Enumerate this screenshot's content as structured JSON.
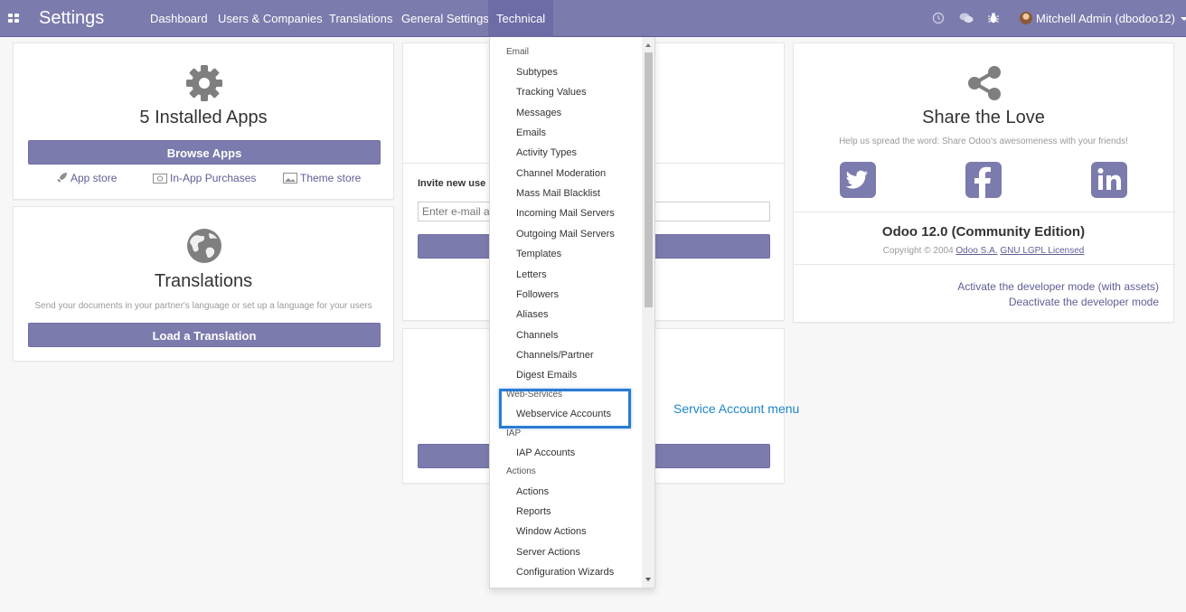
{
  "navbar": {
    "app_title": "Settings",
    "menu": [
      "Dashboard",
      "Users & Companies",
      "Translations",
      "General Settings",
      "Technical"
    ],
    "active_menu": "Technical",
    "user": "Mitchell Admin (dbodoo12)",
    "icons": [
      "apps-grid-icon",
      "clock-icon",
      "chat-icon",
      "bug-icon"
    ]
  },
  "apps_card": {
    "icon": "gear-icon",
    "title": "5 Installed Apps",
    "button": "Browse Apps",
    "links": [
      "App store",
      "In-App Purchases",
      "Theme store"
    ]
  },
  "translations_card": {
    "icon": "globe-icon",
    "title": "Translations",
    "subtitle": "Send your documents in your partner's language or set up a language for your users",
    "button": "Load a Translation"
  },
  "invite_card": {
    "label": "Invite new use",
    "placeholder": "Enter e-mail a"
  },
  "share_card": {
    "icon": "share-icon",
    "title": "Share the Love",
    "subtitle": "Help us spread the word: Share Odoo's awesomeness with your friends!",
    "social": [
      "twitter-icon",
      "facebook-icon",
      "linkedin-icon"
    ],
    "version": "Odoo 12.0 (Community Edition)",
    "copyright_prefix": "Copyright © 2004",
    "company": "Odoo S.A.",
    "license": "GNU LGPL Licensed",
    "dev_links": [
      "Activate the developer mode (with assets)",
      "Deactivate the developer mode"
    ]
  },
  "dropdown": {
    "sections": [
      {
        "header": "Email",
        "items": [
          "Subtypes",
          "Tracking Values",
          "Messages",
          "Emails",
          "Activity Types",
          "Channel Moderation",
          "Mass Mail Blacklist",
          "Incoming Mail Servers",
          "Outgoing Mail Servers",
          "Templates",
          "Letters",
          "Followers",
          "Aliases",
          "Channels",
          "Channels/Partner",
          "Digest Emails"
        ]
      },
      {
        "header": "Web-Services",
        "items": [
          "Webservice Accounts"
        ]
      },
      {
        "header": "IAP",
        "items": [
          "IAP Accounts"
        ]
      },
      {
        "header": "Actions",
        "items": [
          "Actions",
          "Reports",
          "Window Actions",
          "Server Actions",
          "Configuration Wizards"
        ]
      }
    ]
  },
  "annotation": "Service Account menu",
  "colors": {
    "brand": "#7c7bad",
    "highlight": "#2a7bd4",
    "annotation": "#1e86c8"
  }
}
